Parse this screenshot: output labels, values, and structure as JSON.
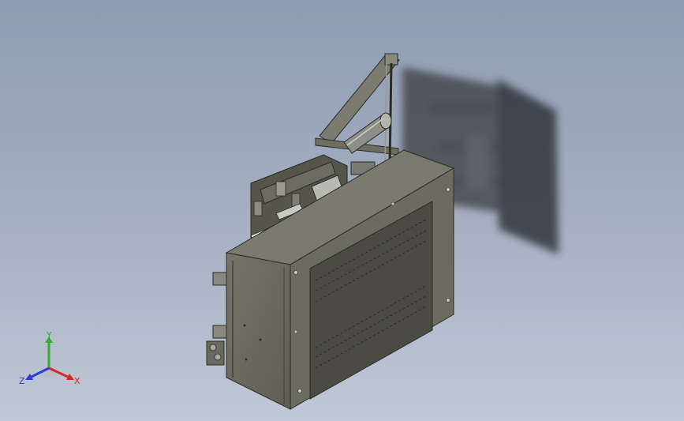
{
  "viewport": {
    "background_top": "#8f9cb3",
    "background_bottom": "#c0c7d6"
  },
  "model": {
    "body_color": "#6e6d60",
    "panel_color": "#4a4a43",
    "edge_color": "#2b2b27",
    "shadow_color": "#2f3235"
  },
  "triad": {
    "x_label": "X",
    "y_label": "Y",
    "z_label": "Z",
    "x_color": "#d42a1e",
    "y_color": "#2fae2f",
    "z_color": "#2a3fd4"
  }
}
